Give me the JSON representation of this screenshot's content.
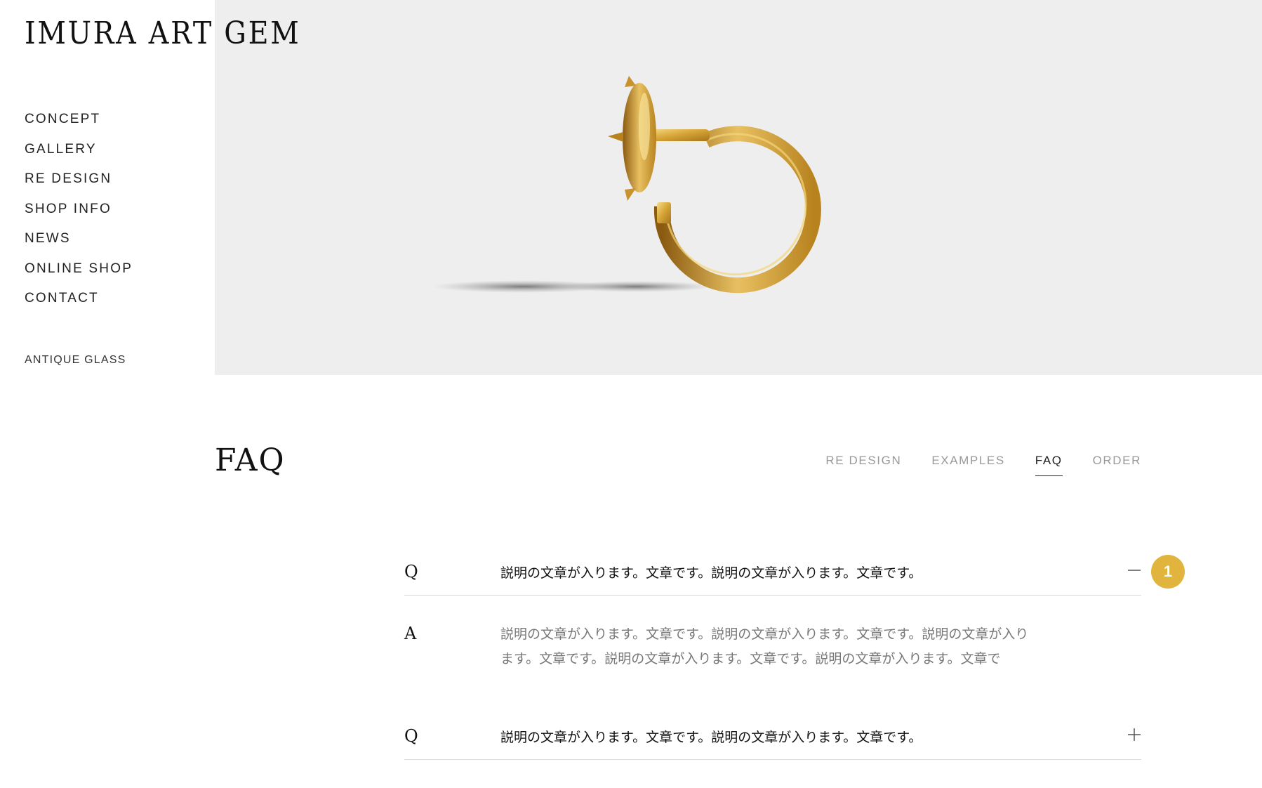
{
  "brand": {
    "logo": "IMURA ART GEM"
  },
  "sidebar": {
    "items": [
      {
        "label": "CONCEPT"
      },
      {
        "label": "GALLERY"
      },
      {
        "label": "RE DESIGN"
      },
      {
        "label": "SHOP INFO"
      },
      {
        "label": "NEWS"
      },
      {
        "label": "ONLINE SHOP"
      },
      {
        "label": "CONTACT"
      }
    ],
    "extra_link": "ANTIQUE GLASS"
  },
  "hero": {
    "image": "gold-hoop-earring-photo",
    "background": "#eeeeee"
  },
  "section": {
    "title": "FAQ",
    "subnav": [
      {
        "label": "RE DESIGN",
        "active": false
      },
      {
        "label": "EXAMPLES",
        "active": false
      },
      {
        "label": "FAQ",
        "active": true
      },
      {
        "label": "ORDER",
        "active": false
      }
    ]
  },
  "faq": {
    "q_marker": "Q",
    "a_marker": "A",
    "items": [
      {
        "question": "説明の文章が入ります。文章です。説明の文章が入ります。文章です。",
        "answer": "説明の文章が入ります。文章です。説明の文章が入ります。文章です。説明の文章が入ります。文章です。説明の文章が入ります。文章です。説明の文章が入ります。文章で",
        "expanded": true,
        "toggle_icon": "minus-icon"
      },
      {
        "question": "説明の文章が入ります。文章です。説明の文章が入ります。文章です。",
        "expanded": false,
        "toggle_icon": "plus-icon"
      }
    ]
  },
  "badge": {
    "value": "1",
    "color": "#e0b43d"
  },
  "colors": {
    "accent": "#e0b43d",
    "text": "#111111",
    "muted": "#999999",
    "divider": "#d9d9d9"
  }
}
